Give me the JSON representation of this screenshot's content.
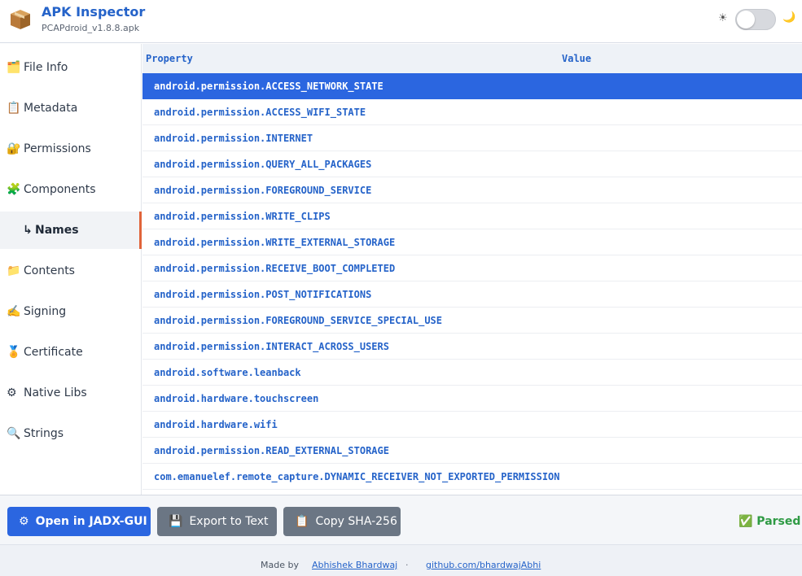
{
  "header": {
    "title": "APK Inspector",
    "subtitle": "PCAPdroid_v1.8.8.apk",
    "logo_icon": "package-box-icon",
    "sun_glyph": "☀",
    "moon_glyph": "🌙",
    "dark_mode": false
  },
  "sidebar": {
    "items": [
      {
        "icon": "🗂️",
        "label": "File Info"
      },
      {
        "icon": "📋",
        "label": "Metadata"
      },
      {
        "icon": "🔐",
        "label": "Permissions"
      },
      {
        "icon": "🧩",
        "label": "Components"
      },
      {
        "icon": "↳",
        "label": "Names"
      },
      {
        "icon": "📁",
        "label": "Contents"
      },
      {
        "icon": "✍️",
        "label": "Signing"
      },
      {
        "icon": "🏅",
        "label": "Certificate"
      },
      {
        "icon": "⚙",
        "label": "Native Libs"
      },
      {
        "icon": "🔍",
        "label": "Strings"
      }
    ],
    "active": "Names"
  },
  "table": {
    "columns": [
      "Property",
      "Value"
    ],
    "rows": [
      "android.permission.ACCESS_NETWORK_STATE",
      "android.permission.ACCESS_WIFI_STATE",
      "android.permission.INTERNET",
      "android.permission.QUERY_ALL_PACKAGES",
      "android.permission.FOREGROUND_SERVICE",
      "android.permission.WRITE_CLIPS",
      "android.permission.WRITE_EXTERNAL_STORAGE",
      "android.permission.RECEIVE_BOOT_COMPLETED",
      "android.permission.POST_NOTIFICATIONS",
      "android.permission.FOREGROUND_SERVICE_SPECIAL_USE",
      "android.permission.INTERACT_ACROSS_USERS",
      "android.software.leanback",
      "android.hardware.touchscreen",
      "android.hardware.wifi",
      "android.permission.READ_EXTERNAL_STORAGE",
      "com.emanuelef.remote_capture.DYNAMIC_RECEIVER_NOT_EXPORTED_PERMISSION"
    ],
    "selected": "android.permission.ACCESS_NETWORK_STATE"
  },
  "actions": {
    "open_icon": "⚙",
    "open_label": "Open in JADX-GUI",
    "export_icon": "💾",
    "export_label": "Export to Text",
    "copy_icon": "📋",
    "copy_label": "Copy SHA-256",
    "status": "✅ Parsed"
  },
  "footer": {
    "made_by": "Made by",
    "author": "Abhishek Bhardwaj",
    "separator": "·",
    "github": "github.com/bhardwajAbhi"
  },
  "colors": {
    "accent": "#2b66e0",
    "active_indicator": "#e0643a",
    "success": "#2e9a44"
  }
}
